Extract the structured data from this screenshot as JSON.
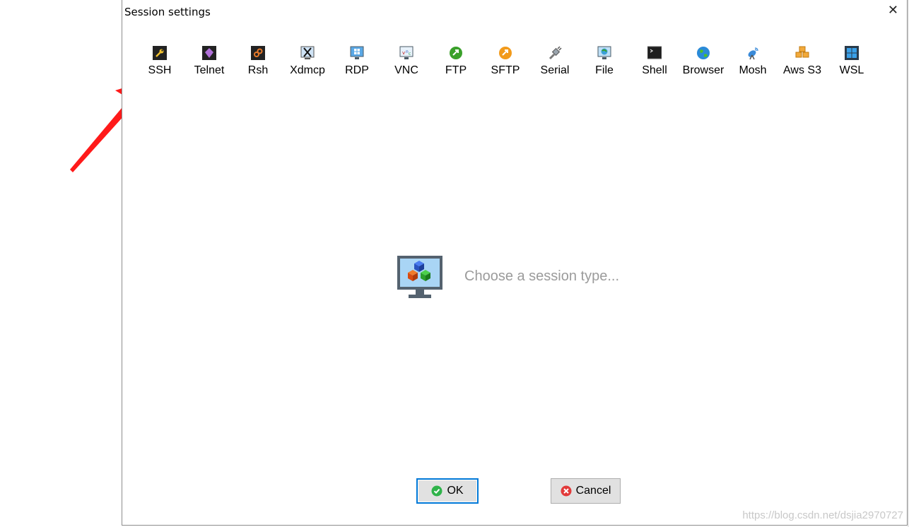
{
  "dialog": {
    "title": "Session settings",
    "close_glyph": "✕"
  },
  "session_types": [
    {
      "label": "SSH",
      "icon": "wrench-icon"
    },
    {
      "label": "Telnet",
      "icon": "telnet-icon"
    },
    {
      "label": "Rsh",
      "icon": "rsh-icon"
    },
    {
      "label": "Xdmcp",
      "icon": "xdmcp-icon"
    },
    {
      "label": "RDP",
      "icon": "rdp-icon"
    },
    {
      "label": "VNC",
      "icon": "vnc-icon"
    },
    {
      "label": "FTP",
      "icon": "ftp-icon"
    },
    {
      "label": "SFTP",
      "icon": "sftp-icon"
    },
    {
      "label": "Serial",
      "icon": "serial-plug-icon"
    },
    {
      "label": "File",
      "icon": "file-icon"
    },
    {
      "label": "Shell",
      "icon": "terminal-icon"
    },
    {
      "label": "Browser",
      "icon": "globe-icon"
    },
    {
      "label": "Mosh",
      "icon": "satellite-icon"
    },
    {
      "label": "Aws S3",
      "icon": "aws-s3-icon"
    },
    {
      "label": "WSL",
      "icon": "windows-icon"
    }
  ],
  "main": {
    "hint": "Choose a session type..."
  },
  "buttons": {
    "ok": "OK",
    "cancel": "Cancel"
  },
  "watermark": "https://blog.csdn.net/dsjia2970727",
  "colors": {
    "accent": "#0078d7",
    "annotation_arrow": "#ff1a1a",
    "hint_text": "#9b9b9b"
  }
}
